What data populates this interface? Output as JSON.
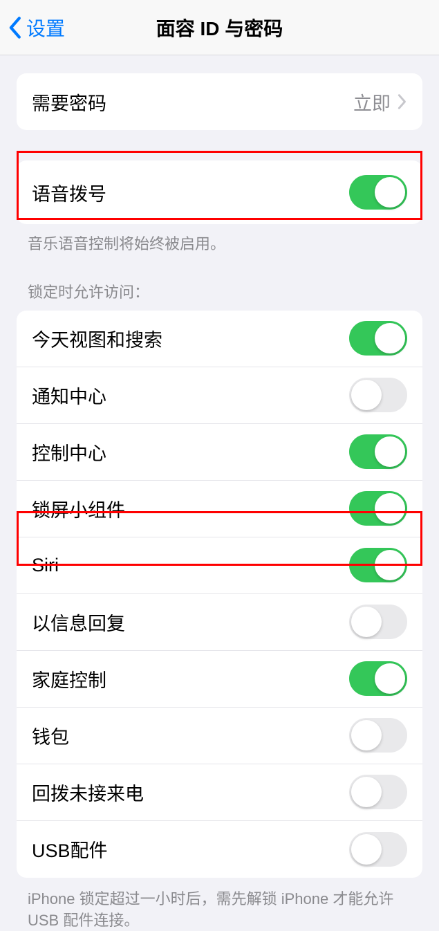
{
  "nav": {
    "back": "设置",
    "title": "面容 ID 与密码"
  },
  "passcode": {
    "label": "需要密码",
    "value": "立即"
  },
  "voice": {
    "label": "语音拨号",
    "on": true
  },
  "voice_footer": "音乐语音控制将始终被启用。",
  "lock_header": "锁定时允许访问：",
  "lock": {
    "items": [
      {
        "label": "今天视图和搜索",
        "on": true
      },
      {
        "label": "通知中心",
        "on": false
      },
      {
        "label": "控制中心",
        "on": true
      },
      {
        "label": "锁屏小组件",
        "on": true
      },
      {
        "label": "Siri",
        "on": true
      },
      {
        "label": "以信息回复",
        "on": false
      },
      {
        "label": "家庭控制",
        "on": true
      },
      {
        "label": "钱包",
        "on": false
      },
      {
        "label": "回拨未接来电",
        "on": false
      },
      {
        "label": "USB配件",
        "on": false
      }
    ]
  },
  "usb_footer": "iPhone 锁定超过一小时后，需先解锁 iPhone 才能允许USB 配件连接。"
}
